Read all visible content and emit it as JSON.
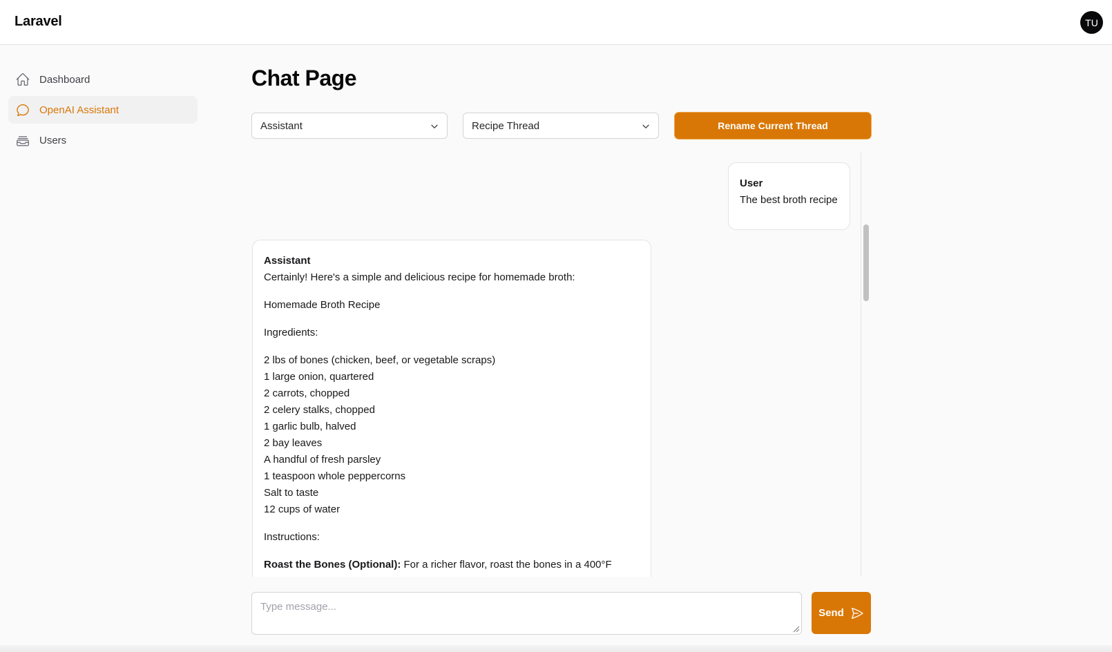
{
  "app": {
    "brand": "Laravel",
    "user_initials": "TU"
  },
  "sidebar": {
    "items": [
      {
        "label": "Dashboard",
        "icon": "home-icon",
        "active": false
      },
      {
        "label": "OpenAI Assistant",
        "icon": "chat-bubble-icon",
        "active": true
      },
      {
        "label": "Users",
        "icon": "inbox-stack-icon",
        "active": false
      }
    ]
  },
  "main": {
    "title": "Chat Page",
    "assistant_select": {
      "selected": "Assistant"
    },
    "thread_select": {
      "selected": "Recipe Thread"
    },
    "rename_button": "Rename Current Thread"
  },
  "chat": {
    "user_message": {
      "sender": "User",
      "text": "The best broth recipe"
    },
    "assistant_message": {
      "sender": "Assistant",
      "intro": "Certainly! Here's a simple and delicious recipe for homemade broth:",
      "recipe_title": "Homemade Broth Recipe",
      "ingredients_heading": "Ingredients:",
      "ingredients": [
        "2 lbs of bones (chicken, beef, or vegetable scraps)",
        "1 large onion, quartered",
        "2 carrots, chopped",
        "2 celery stalks, chopped",
        "1 garlic bulb, halved",
        "2 bay leaves",
        "A handful of fresh parsley",
        "1 teaspoon whole peppercorns",
        "Salt to taste",
        "12 cups of water"
      ],
      "instructions_heading": "Instructions:",
      "step1_title": "Roast the Bones (Optional):",
      "step1_text": " For a richer flavor, roast the bones in a 400°F"
    }
  },
  "composer": {
    "placeholder": "Type message...",
    "value": "",
    "send_label": "Send"
  },
  "colors": {
    "accent": "#d97706",
    "text": "#18181b",
    "border": "#e4e4e7",
    "background": "#fafafa"
  }
}
